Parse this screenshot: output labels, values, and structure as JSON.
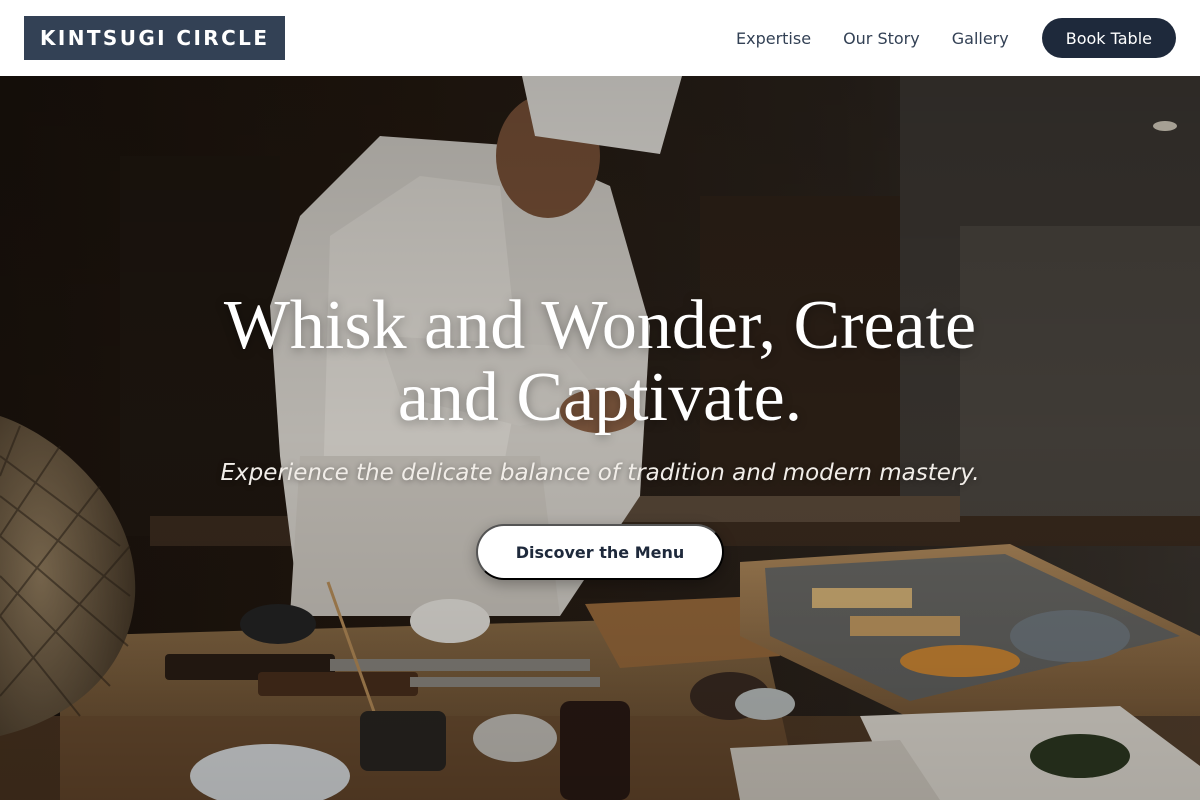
{
  "brand": {
    "name": "KINTSUGI CIRCLE"
  },
  "nav": {
    "links": [
      {
        "label": "Expertise"
      },
      {
        "label": "Our Story"
      },
      {
        "label": "Gallery"
      }
    ],
    "book_label": "Book Table"
  },
  "hero": {
    "title_line1": "Whisk and Wonder, Create",
    "title_line2": "and Captivate.",
    "subtitle": "Experience the delicate balance of tradition and modern mastery.",
    "cta_label": "Discover the Menu",
    "background_image": "chef-at-sushi-counter"
  },
  "colors": {
    "brand_bg": "#334155",
    "nav_text": "#334155",
    "button_dark": "#1e293b",
    "hero_text": "#ffffff"
  }
}
